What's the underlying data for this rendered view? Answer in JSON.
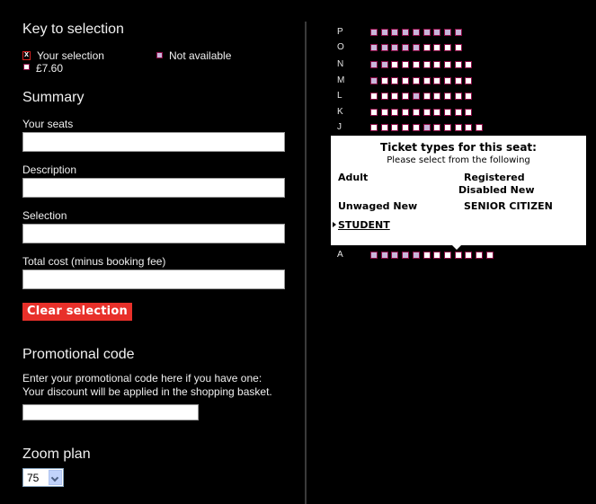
{
  "key": {
    "heading": "Key to selection",
    "your_selection": "Your selection",
    "your_selection_mark": "x",
    "not_available": "Not available",
    "price": "£7.60"
  },
  "summary": {
    "heading": "Summary",
    "your_seats_label": "Your seats",
    "your_seats_value": "",
    "description_label": "Description",
    "description_value": "",
    "selection_label": "Selection",
    "selection_value": "",
    "total_cost_label": "Total cost (minus booking fee)",
    "total_cost_value": "",
    "clear_button": "Clear selection"
  },
  "promo": {
    "heading": "Promotional code",
    "line1": "Enter your promotional code here if you have one:",
    "line2": "Your discount will be applied in the shopping basket.",
    "value": ""
  },
  "zoom": {
    "heading": "Zoom plan",
    "selected": "75"
  },
  "colors": {
    "available_fill": "#ffffff",
    "unavailable_fill": "#c9b6da",
    "seat_border": "#8a0a45",
    "button_red": "#e8302a"
  },
  "seat_map": {
    "rows": [
      {
        "label": "P",
        "seats": [
          "u",
          "u",
          "u",
          "u",
          "u",
          "u",
          "u",
          "u",
          "u"
        ]
      },
      {
        "label": "O",
        "seats": [
          "u",
          "u",
          "u",
          "u",
          "u",
          "a",
          "a",
          "a",
          "a"
        ]
      },
      {
        "label": "N",
        "seats": [
          "u",
          "u",
          "a",
          "a",
          "a",
          "a",
          "a",
          "a",
          "a",
          "a"
        ]
      },
      {
        "label": "M",
        "seats": [
          "u",
          "a",
          "a",
          "a",
          "a",
          "a",
          "a",
          "a",
          "a",
          "a"
        ]
      },
      {
        "label": "L",
        "seats": [
          "a",
          "a",
          "a",
          "a",
          "u",
          "a",
          "a",
          "a",
          "a",
          "a"
        ]
      },
      {
        "label": "K",
        "seats": [
          "a",
          "a",
          "a",
          "a",
          "a",
          "a",
          "a",
          "a",
          "a",
          "a"
        ]
      },
      {
        "label": "J",
        "seats": [
          "a",
          "a",
          "a",
          "a",
          "a",
          "u",
          "a",
          "a",
          "a",
          "a",
          "a"
        ]
      },
      {
        "label": "A",
        "seats": [
          "u",
          "u",
          "u",
          "u",
          "u",
          "a",
          "a",
          "a",
          "a",
          "a",
          "a",
          "a"
        ]
      }
    ]
  },
  "popup": {
    "title": "Ticket types for this seat:",
    "subtitle": "Please select from the following",
    "options": [
      "Adult",
      "Registered Disabled New",
      "Unwaged New",
      "SENIOR CITIZEN",
      "STUDENT"
    ],
    "opt_registered_line1": "Registered",
    "opt_registered_line2": "Disabled New",
    "selected": "STUDENT"
  }
}
